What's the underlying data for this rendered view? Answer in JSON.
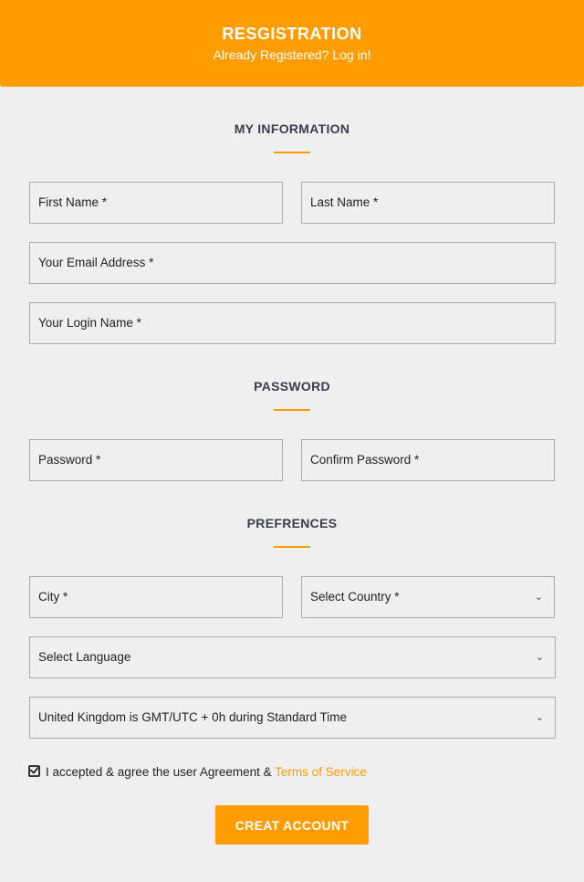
{
  "header": {
    "title": "RESGISTRATION",
    "subtitle": "Already Registered? Log in!"
  },
  "sections": {
    "info": "MY INFORMATION",
    "password": "PASSWORD",
    "prefs": "PREFRENCES"
  },
  "fields": {
    "first_name": "First Name *",
    "last_name": "Last Name *",
    "email": "Your Email Address *",
    "login": "Your Login Name *",
    "password": "Password *",
    "confirm": "Confirm Password *",
    "city": "City *",
    "country": "Select Country *",
    "language": "Select Language",
    "timezone": "United Kingdom is GMT/UTC + 0h during Standard Time"
  },
  "agreement": {
    "checked": true,
    "text": "I accepted & agree the user Agreement & ",
    "link": "Terms of Service"
  },
  "submit": "CREAT ACCOUNT",
  "colors": {
    "accent": "#ff9c00",
    "background": "#efefef"
  }
}
